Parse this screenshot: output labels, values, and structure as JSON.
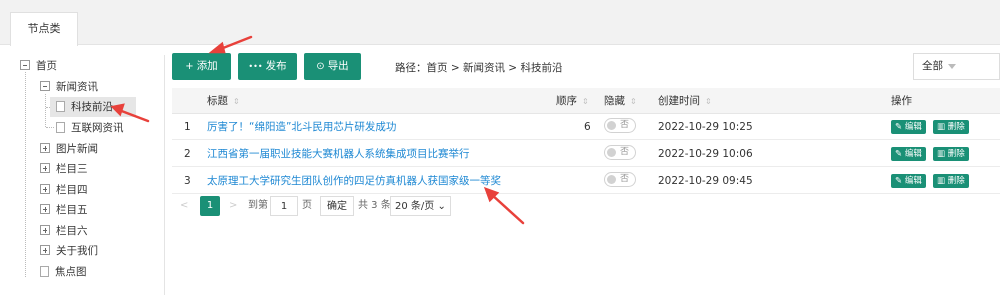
{
  "tab": {
    "label": "节点类"
  },
  "tree": {
    "home": "首页",
    "news": "新闻资讯",
    "sci": "科技前沿",
    "internet": "互联网资讯",
    "photo": "图片新闻",
    "col3": "栏目三",
    "col4": "栏目四",
    "col5": "栏目五",
    "col6": "栏目六",
    "about": "关于我们",
    "focus": "焦点图"
  },
  "toolbar": {
    "add_label": "添加",
    "publish_label": "发布",
    "export_label": "导出",
    "path": "路径：首页 > 新闻资讯 > 科技前沿",
    "filter_value": "全部"
  },
  "table": {
    "headers": {
      "title": "标题",
      "order": "顺序",
      "hidden": "隐藏",
      "created": "创建时间",
      "ops": "操作"
    },
    "rows": [
      {
        "index": "1",
        "title": "厉害了！“绵阳造”北斗民用芯片研发成功",
        "order": "6",
        "hidden": "否",
        "created": "2022-10-29 10:25"
      },
      {
        "index": "2",
        "title": "江西省第一届职业技能大赛机器人系统集成项目比赛举行",
        "order": "",
        "hidden": "否",
        "created": "2022-10-29 10:06"
      },
      {
        "index": "3",
        "title": "太原理工大学研究生团队创作的四足仿真机器人获国家级一等奖",
        "order": "",
        "hidden": "否",
        "created": "2022-10-29 09:45"
      }
    ],
    "edit_label": "编辑",
    "delete_label": "删除"
  },
  "pager": {
    "prev": "<",
    "current": "1",
    "next": ">",
    "goto_label": "到第",
    "page_input": "1",
    "page_unit": "页",
    "confirm": "确定",
    "total": "共 3 条",
    "page_size": "20 条/页"
  },
  "colors": {
    "accent": "#1a9076",
    "link": "#1e88d3",
    "annotation": "#e8413b"
  },
  "icons": {
    "add": "plus-icon",
    "publish": "publish-icon",
    "export": "download-icon",
    "edit": "pencil-icon",
    "delete": "trash-icon"
  }
}
